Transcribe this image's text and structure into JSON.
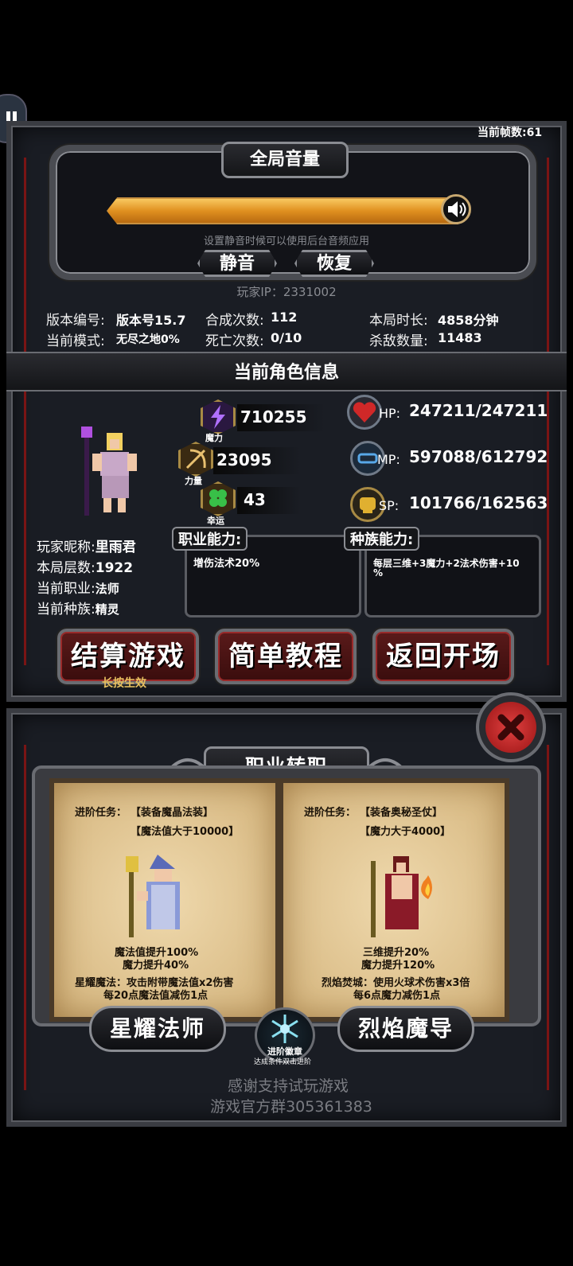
{
  "fps": "当前帧数:61",
  "volume": {
    "title": "全局音量",
    "level": 1.0,
    "hint": "设置静音时候可以使用后台音频应用",
    "mute_label": "静音",
    "restore_label": "恢复",
    "player_ip": "玩家IP：2331002"
  },
  "stats": {
    "version_label": "版本编号:",
    "version_value": "版本号15.7",
    "mode_label": "当前模式:",
    "mode_value": "无尽之地0%",
    "synth_label": "合成次数:",
    "synth_value": "112",
    "death_label": "死亡次数:",
    "death_value": "0/10",
    "duration_label": "本局时长:",
    "duration_value": "4858分钟",
    "kills_label": "杀敌数量:",
    "kills_value": "11483"
  },
  "character": {
    "section_title": "当前角色信息",
    "magic_value": "710255",
    "magic_label": "魔力",
    "strength_value": "23095",
    "strength_label": "力量",
    "luck_value": "43",
    "luck_label": "幸运",
    "hp_label": "HP:",
    "hp_value": "247211/247211",
    "mp_label": "MP:",
    "mp_value": "597088/612792",
    "sp_label": "SP:",
    "sp_value": "101766/162563",
    "nickname_label": "玩家昵称:",
    "nickname": "里雨君",
    "floor_label": "本局层数:",
    "floor": "1922",
    "job_label": "当前职业:",
    "job": "法师",
    "race_label": "当前种族:",
    "race": "精灵",
    "job_ability_title": "职业能力:",
    "job_ability_text": "增伤法术20%",
    "race_ability_title": "种族能力:",
    "race_ability_line1": "每层三维+3魔力+2法术伤害+10",
    "race_ability_line2": "%"
  },
  "buttons": {
    "settle": "结算游戏",
    "settle_hint": "长按生效",
    "tutorial": "简单教程",
    "back": "返回开场"
  },
  "class_change": {
    "title": "职业转职",
    "left": {
      "task_label": "进阶任务：",
      "task1": "【装备魔晶法装】",
      "task2": "【魔法值大于10000】",
      "bonus1": "魔法值提升100%",
      "bonus2": "魔力提升40%",
      "skill_line1": "星耀魔法：攻击附带魔法值x2伤害",
      "skill_line2": "每20点魔法值减伤1点",
      "name": "星耀法师"
    },
    "right": {
      "task_label": "进阶任务：",
      "task1": "【装备奥秘圣仗】",
      "task2": "【魔力大于4000】",
      "bonus1": "三维提升20%",
      "bonus2": "魔力提升120%",
      "skill_line1": "烈焰焚城：使用火球术伤害x3倍",
      "skill_line2": "每6点魔力减伤1点",
      "name": "烈焰魔导"
    },
    "badge_title": "进阶徽章",
    "badge_hint": "达成条件双击进阶"
  },
  "footer": {
    "line1": "感谢支持试玩游戏",
    "line2": "游戏官方群305361383"
  },
  "colors": {
    "accent_red": "#8a1a1a",
    "volume_bar": "#e8a030",
    "parchment": "#e6cc99"
  }
}
